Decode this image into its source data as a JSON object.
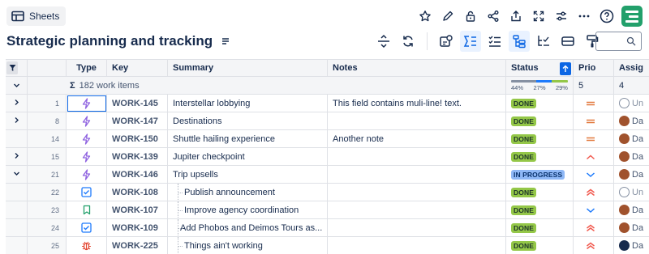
{
  "toolbar": {
    "sheets_label": "Sheets",
    "icons": [
      "star-icon",
      "edit-icon",
      "lock-icon",
      "share-icon",
      "upload-icon",
      "fullscreen-icon",
      "settings-sliders-icon",
      "more-icon",
      "help-icon"
    ]
  },
  "page": {
    "title": "Strategic planning and tracking"
  },
  "columns": {
    "type": "Type",
    "key": "Key",
    "summary": "Summary",
    "notes": "Notes",
    "status": "Status",
    "prio": "Prio",
    "assignee": "Assig"
  },
  "group": {
    "sigma": "Σ",
    "label": "182 work items",
    "progress_labels": [
      "44%",
      "27%",
      "29%"
    ],
    "progress_values": [
      0.44,
      0.27,
      0.29
    ],
    "progress_colors": [
      "#8590a2",
      "#1d7afc",
      "#94c748"
    ],
    "prio_count": "5",
    "assignee_count": "4"
  },
  "rows": [
    {
      "num": "1",
      "key": "WORK-145",
      "summary": "Interstellar lobbying",
      "notes": "This field contains muli-line! text.",
      "status": "DONE",
      "prio": "medium",
      "assignee": "Un",
      "avatar": "gray",
      "type": "epic",
      "expand": "collapsed"
    },
    {
      "num": "8",
      "key": "WORK-147",
      "summary": "Destinations",
      "notes": "",
      "status": "DONE",
      "prio": "medium",
      "assignee": "Da",
      "avatar": "brown",
      "type": "epic",
      "expand": "collapsed"
    },
    {
      "num": "14",
      "key": "WORK-150",
      "summary": "Shuttle hailing experience",
      "notes": "Another note",
      "status": "DONE",
      "prio": "medium",
      "assignee": "Da",
      "avatar": "brown",
      "type": "epic",
      "expand": "none"
    },
    {
      "num": "15",
      "key": "WORK-139",
      "summary": "Jupiter checkpoint",
      "notes": "",
      "status": "DONE",
      "prio": "high",
      "assignee": "Da",
      "avatar": "brown",
      "type": "epic",
      "expand": "collapsed"
    },
    {
      "num": "21",
      "key": "WORK-146",
      "summary": "Trip upsells",
      "notes": "",
      "status": "IN PROGRESS",
      "prio": "low",
      "assignee": "Da",
      "avatar": "brown",
      "type": "epic",
      "expand": "expanded"
    },
    {
      "num": "22",
      "key": "WORK-108",
      "summary": "Publish announcement",
      "notes": "",
      "status": "DONE",
      "prio": "highest",
      "assignee": "Un",
      "avatar": "gray",
      "type": "task",
      "expand": "child"
    },
    {
      "num": "23",
      "key": "WORK-107",
      "summary": "Improve agency coordination",
      "notes": "",
      "status": "DONE",
      "prio": "low",
      "assignee": "Da",
      "avatar": "brown",
      "type": "story",
      "expand": "child"
    },
    {
      "num": "24",
      "key": "WORK-109",
      "summary": "Add Phobos and Deimos Tours as...",
      "notes": "",
      "status": "DONE",
      "prio": "highest",
      "assignee": "Da",
      "avatar": "brown",
      "type": "task",
      "expand": "child"
    },
    {
      "num": "25",
      "key": "WORK-225",
      "summary": "Things ain't working",
      "notes": "",
      "status": "DONE",
      "prio": "highest",
      "assignee": "Da",
      "avatar": "dark",
      "type": "bug",
      "expand": "child"
    }
  ],
  "colors": {
    "epic": "#8f63e0",
    "task": "#1d7afc",
    "story": "#22a06b",
    "bug": "#e34935",
    "prio_medium": "#e2793d",
    "prio_high": "#f15b50",
    "prio_low": "#1d7afc"
  }
}
